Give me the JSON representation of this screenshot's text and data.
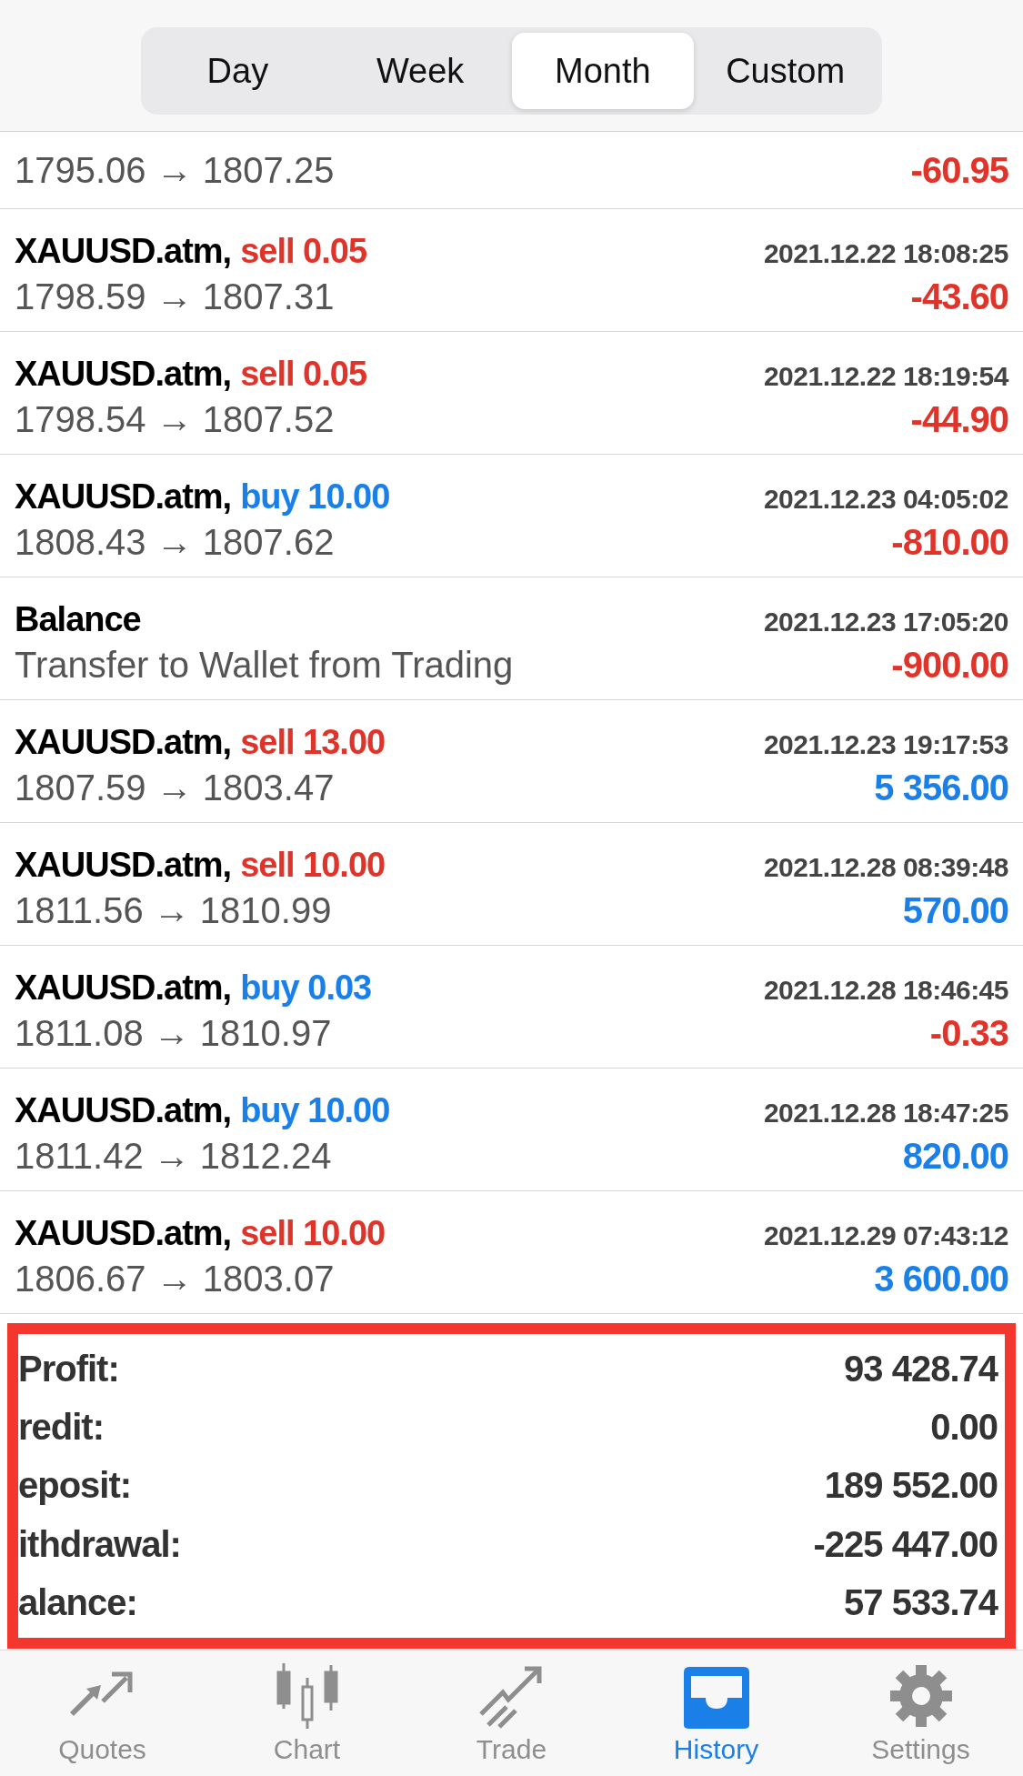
{
  "periods": [
    {
      "label": "Day",
      "selected": false
    },
    {
      "label": "Week",
      "selected": false
    },
    {
      "label": "Month",
      "selected": true
    },
    {
      "label": "Custom",
      "selected": false
    }
  ],
  "deals": [
    {
      "kind": "partial",
      "prices": "1795.06 → 1807.25",
      "profit": "-60.95",
      "negative": true
    },
    {
      "kind": "sell",
      "symbol": "XAUUSD.atm,",
      "volume": "sell 0.05",
      "time": "2021.12.22 18:08:25",
      "prices": "1798.59 → 1807.31",
      "profit": "-43.60",
      "negative": true
    },
    {
      "kind": "sell",
      "symbol": "XAUUSD.atm,",
      "volume": "sell 0.05",
      "time": "2021.12.22 18:19:54",
      "prices": "1798.54 → 1807.52",
      "profit": "-44.90",
      "negative": true
    },
    {
      "kind": "buy",
      "symbol": "XAUUSD.atm,",
      "volume": "buy 10.00",
      "time": "2021.12.23 04:05:02",
      "prices": "1808.43 → 1807.62",
      "profit": "-810.00",
      "negative": true
    },
    {
      "kind": "balance",
      "symbol": "Balance",
      "time": "2021.12.23 17:05:20",
      "prices": "Transfer to Wallet from Trading",
      "profit": "-900.00",
      "negative": true
    },
    {
      "kind": "sell",
      "symbol": "XAUUSD.atm,",
      "volume": "sell 13.00",
      "time": "2021.12.23 19:17:53",
      "prices": "1807.59 → 1803.47",
      "profit": "5 356.00",
      "negative": false
    },
    {
      "kind": "sell",
      "symbol": "XAUUSD.atm,",
      "volume": "sell 10.00",
      "time": "2021.12.28 08:39:48",
      "prices": "1811.56 → 1810.99",
      "profit": "570.00",
      "negative": false
    },
    {
      "kind": "buy",
      "symbol": "XAUUSD.atm,",
      "volume": "buy 0.03",
      "time": "2021.12.28 18:46:45",
      "prices": "1811.08 → 1810.97",
      "profit": "-0.33",
      "negative": true
    },
    {
      "kind": "buy",
      "symbol": "XAUUSD.atm,",
      "volume": "buy 10.00",
      "time": "2021.12.28 18:47:25",
      "prices": "1811.42 → 1812.24",
      "profit": "820.00",
      "negative": false
    },
    {
      "kind": "sell",
      "symbol": "XAUUSD.atm,",
      "volume": "sell 10.00",
      "time": "2021.12.29 07:43:12",
      "prices": "1806.67 → 1803.07",
      "profit": "3 600.00",
      "negative": false
    }
  ],
  "summary": [
    {
      "label": "Profit:",
      "value": "93 428.74"
    },
    {
      "label": "redit:",
      "value": "0.00"
    },
    {
      "label": "eposit:",
      "value": "189 552.00"
    },
    {
      "label": "ithdrawal:",
      "value": "-225 447.00"
    },
    {
      "label": "alance:",
      "value": "57 533.74"
    }
  ],
  "tab_bar": [
    {
      "label": "Quotes",
      "selected": false
    },
    {
      "label": "Chart",
      "selected": false
    },
    {
      "label": "Trade",
      "selected": false
    },
    {
      "label": "History",
      "selected": true
    },
    {
      "label": "Settings",
      "selected": false
    }
  ]
}
